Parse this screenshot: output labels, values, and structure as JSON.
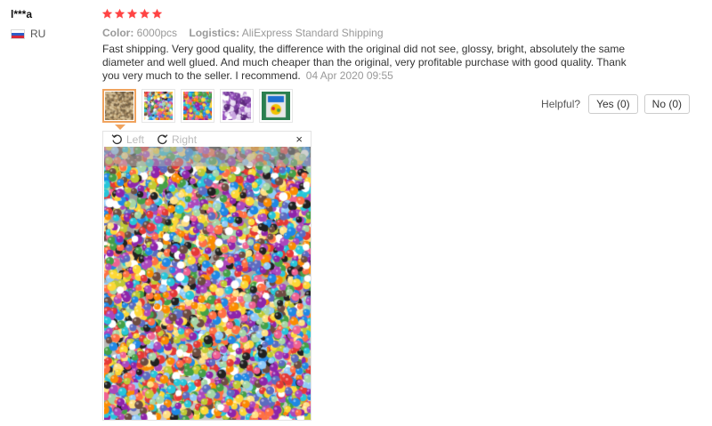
{
  "review": {
    "user_name": "l***a",
    "country_code": "RU",
    "rating": 5,
    "color_label": "Color:",
    "color_value": "6000pcs",
    "logistics_label": "Logistics:",
    "logistics_value": "AliExpress Standard Shipping",
    "text": "Fast shipping. Very good quality, the difference with the original did not see, glossy, bright, absolutely the same diameter and well glued. And much cheaper than the original, very profitable purchase with good quality. Thank you very much to the seller. I recommend.",
    "date": "04 Apr 2020 09:55"
  },
  "helpful": {
    "label": "Helpful?",
    "yes_label": "Yes (0)",
    "no_label": "No (0)"
  },
  "viewer": {
    "rotate_left_label": "Left",
    "rotate_right_label": "Right",
    "close_label": "×"
  },
  "colors": {
    "star": "#f44",
    "active_thumb_border": "#f0a35e"
  }
}
